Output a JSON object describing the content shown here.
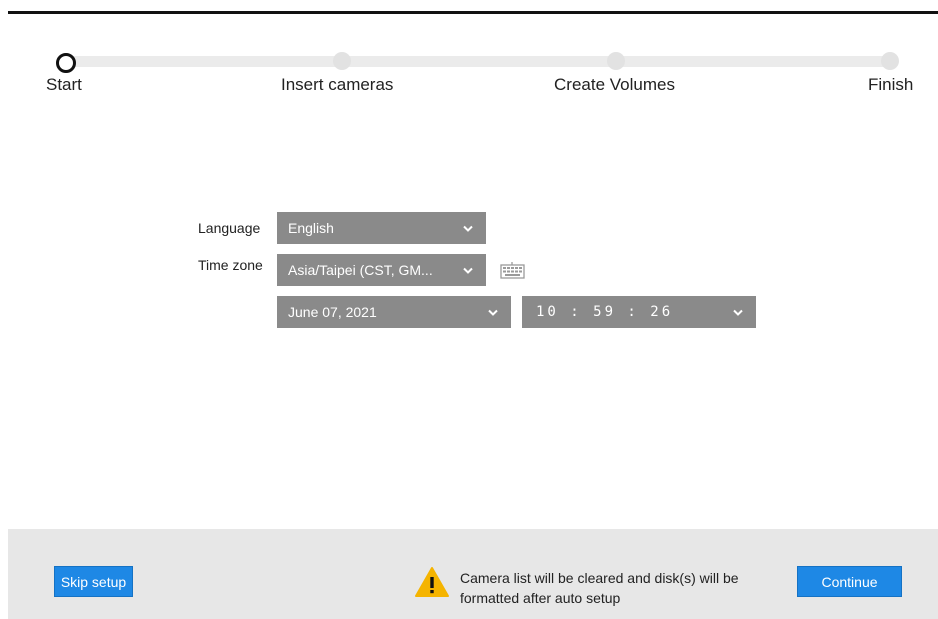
{
  "stepper": {
    "steps": [
      {
        "label": "Start",
        "state": "active"
      },
      {
        "label": "Insert cameras",
        "state": "inactive"
      },
      {
        "label": "Create Volumes",
        "state": "inactive"
      },
      {
        "label": "Finish",
        "state": "inactive"
      }
    ]
  },
  "form": {
    "language": {
      "label": "Language",
      "value": "English"
    },
    "timezone": {
      "label": "Time zone",
      "value": "Asia/Taipei (CST, GM..."
    },
    "date": {
      "value": "June 07, 2021"
    },
    "time": {
      "value": "10 : 59 : 26"
    },
    "keyboard_icon": "keyboard-icon"
  },
  "footer": {
    "skip_label": "Skip setup",
    "warning_text": "Camera list will be cleared and disk(s) will be formatted after auto setup",
    "warning_icon": "warning-icon",
    "continue_label": "Continue"
  },
  "colors": {
    "accent": "#1e88e5",
    "field_bg": "#8a8a8a",
    "footer_bg": "#e7e7e7",
    "warning": "#f5b400"
  }
}
